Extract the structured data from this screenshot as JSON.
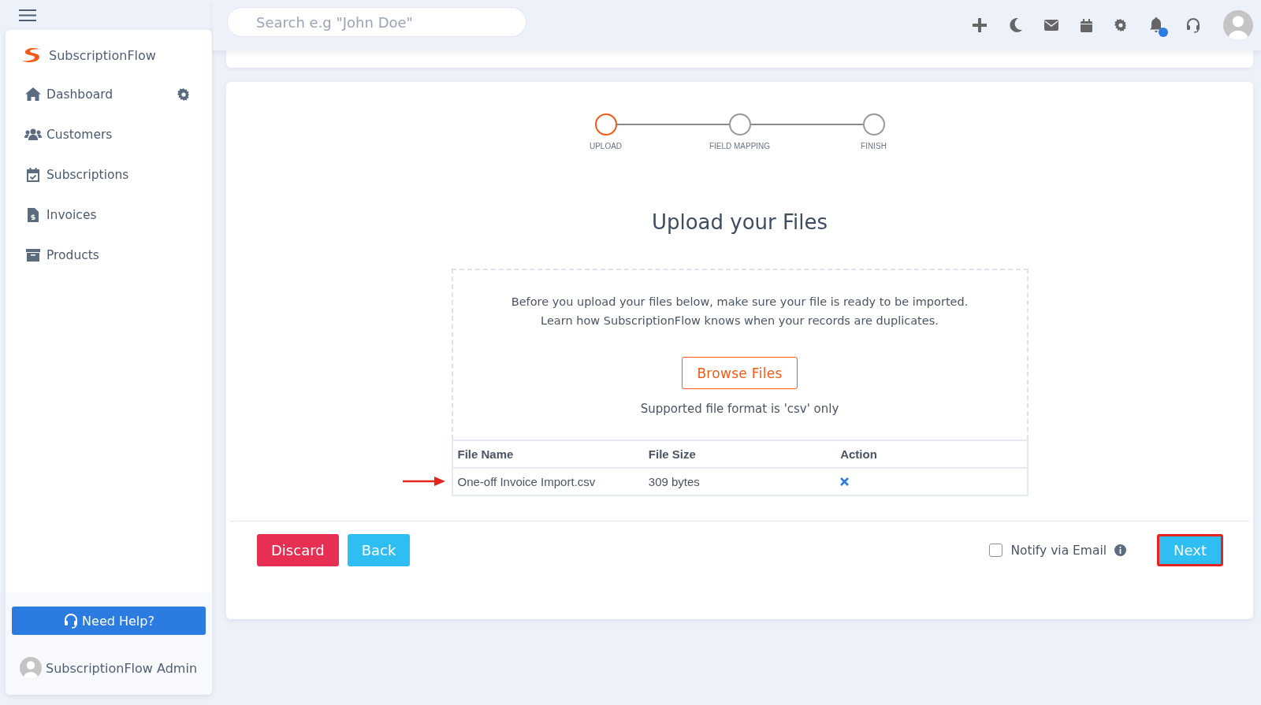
{
  "topbar": {
    "search": {
      "placeholder": "Search e.g \"John Doe\""
    },
    "notification_dot": true
  },
  "sidebar": {
    "brand": "SubscriptionFlow",
    "items": [
      {
        "label": "Dashboard",
        "has_settings": true
      },
      {
        "label": "Customers",
        "has_settings": false
      },
      {
        "label": "Subscriptions",
        "has_settings": false
      },
      {
        "label": "Invoices",
        "has_settings": false
      },
      {
        "label": "Products",
        "has_settings": false
      }
    ],
    "help_button": "Need Help?",
    "user": "SubscriptionFlow Admin"
  },
  "wizard": {
    "steps": [
      {
        "label": "UPLOAD",
        "current": true
      },
      {
        "label": "FIELD MAPPING",
        "current": false
      },
      {
        "label": "FINISH",
        "current": false
      }
    ],
    "title": "Upload your Files",
    "intro": [
      "Before you upload your files below, make sure your file is ready to be imported.",
      "Learn how SubscriptionFlow knows when your records are duplicates."
    ],
    "browse_button": "Browse Files",
    "format_note": "Supported file format is 'csv' only",
    "table": {
      "columns": [
        "File Name",
        "File Size",
        "Action"
      ],
      "rows": [
        {
          "file_name": "One-off Invoice Import.csv",
          "file_size": "309 bytes",
          "arrow_marked": true
        }
      ]
    },
    "buttons": {
      "discard": "Discard",
      "back": "Back",
      "next": "Next",
      "next_highlighted": true
    },
    "notify": {
      "label": "Notify via Email",
      "checked": false
    }
  }
}
